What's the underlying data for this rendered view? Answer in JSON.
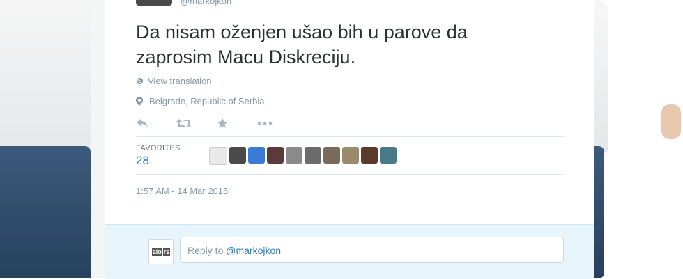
{
  "tweet": {
    "handle_partial": "@markojkon",
    "text_line1": "Da nisam oženjen ušao bih u parove da",
    "text_line2": "zaprosim Macu Diskreciju.",
    "view_translation": "View translation",
    "location": "Belgrade, Republic of Serbia",
    "favorites_label": "FAVORITES",
    "favorites_count": "28",
    "timestamp": "1:57 AM - 14 Mar 2015"
  },
  "actions": {
    "reply_icon": "reply-icon",
    "retweet_icon": "retweet-icon",
    "favorite_icon": "star-icon",
    "more_icon": "more-icon"
  },
  "reply": {
    "prefix": "Reply to ",
    "mention": "@markojkon",
    "logo_left": "alo",
    "logo_right": "rs"
  },
  "favoriters": [
    {
      "name": "favoriter-avatar",
      "color": "#e9e9e9"
    },
    {
      "name": "favoriter-avatar",
      "color": "#4a4a4a"
    },
    {
      "name": "favoriter-avatar",
      "color": "#3a7bd5"
    },
    {
      "name": "favoriter-avatar",
      "color": "#5a3a3a"
    },
    {
      "name": "favoriter-avatar",
      "color": "#8a8a8a"
    },
    {
      "name": "favoriter-avatar",
      "color": "#6b6b6b"
    },
    {
      "name": "favoriter-avatar",
      "color": "#7a6a5a"
    },
    {
      "name": "favoriter-avatar",
      "color": "#9a8a6a"
    },
    {
      "name": "favoriter-avatar",
      "color": "#5a3b2a"
    },
    {
      "name": "favoriter-avatar",
      "color": "#4a7a8a"
    }
  ],
  "colors": {
    "link": "#2b7bb9",
    "meta": "#8899a6",
    "text": "#292f33",
    "reply_bg": "#e8f4fb"
  }
}
